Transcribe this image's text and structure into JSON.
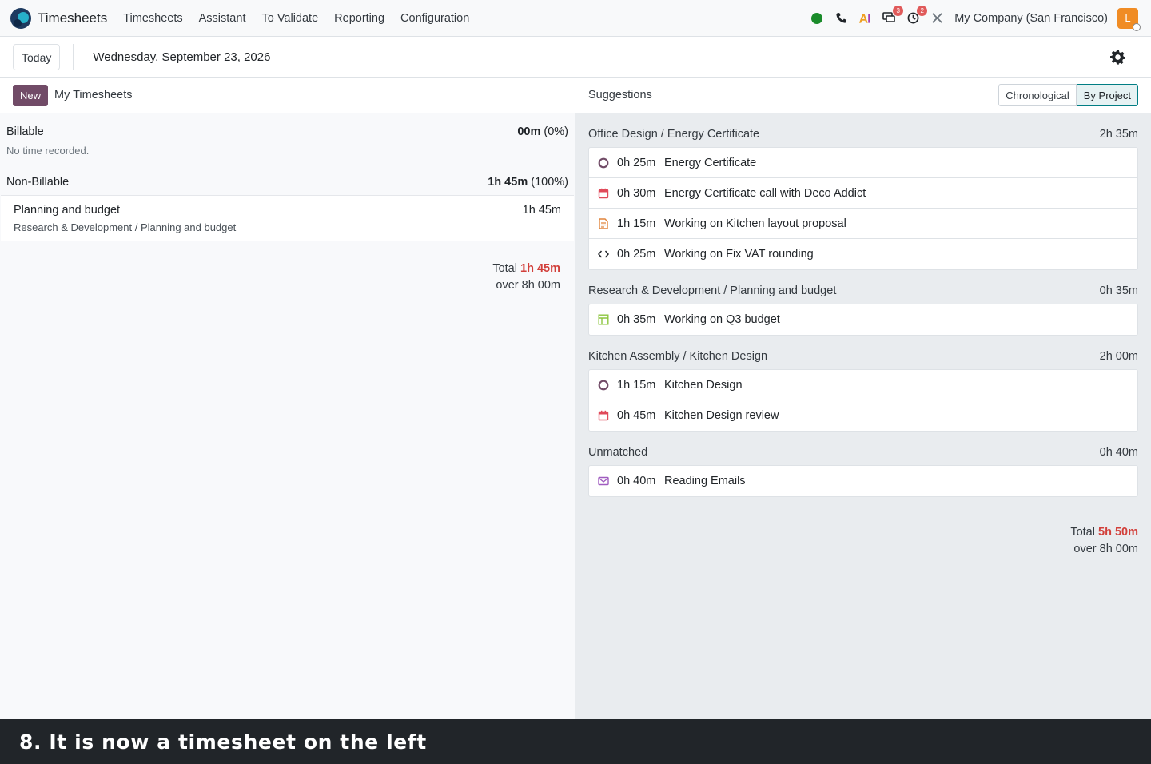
{
  "navbar": {
    "app_name": "Timesheets",
    "menu": [
      "Timesheets",
      "Assistant",
      "To Validate",
      "Reporting",
      "Configuration"
    ],
    "company": "My Company (San Francisco)",
    "avatar_letter": "L",
    "badges": {
      "messages": "3",
      "activities": "2"
    },
    "icons": [
      "status-online-icon",
      "phone-icon",
      "ai-icon",
      "chat-icon",
      "clock-icon",
      "tools-icon"
    ]
  },
  "controlbar": {
    "today_label": "Today",
    "date": "Wednesday, September 23, 2026"
  },
  "left": {
    "new_label": "New",
    "title": "My Timesheets",
    "billable": {
      "label": "Billable",
      "value": "00m",
      "percent": "(0%)",
      "empty_text": "No time recorded."
    },
    "non_billable": {
      "label": "Non-Billable",
      "value": "1h 45m",
      "percent": "(100%)"
    },
    "entries": [
      {
        "title": "Planning and budget",
        "subtitle": "Research & Development / Planning and budget",
        "duration": "1h 45m"
      }
    ],
    "total_label": "Total",
    "total_value": "1h 45m",
    "over_text": "over 8h 00m"
  },
  "right": {
    "title": "Suggestions",
    "view_chronological": "Chronological",
    "view_by_project": "By Project",
    "groups": [
      {
        "name": "Office Design / Energy Certificate",
        "total": "2h 35m",
        "items": [
          {
            "icon": "task-circle-icon",
            "duration": "0h 25m",
            "name": "Energy Certificate"
          },
          {
            "icon": "calendar-icon",
            "duration": "0h 30m",
            "name": "Energy Certificate call with Deco Addict"
          },
          {
            "icon": "document-icon",
            "duration": "1h 15m",
            "name": "Working on Kitchen layout proposal"
          },
          {
            "icon": "code-icon",
            "duration": "0h 25m",
            "name": "Working on Fix VAT rounding"
          }
        ]
      },
      {
        "name": "Research & Development / Planning and budget",
        "total": "0h 35m",
        "items": [
          {
            "icon": "spreadsheet-icon",
            "duration": "0h 35m",
            "name": "Working on Q3 budget"
          }
        ]
      },
      {
        "name": "Kitchen Assembly / Kitchen Design",
        "total": "2h 00m",
        "items": [
          {
            "icon": "task-circle-icon",
            "duration": "1h 15m",
            "name": "Kitchen Design"
          },
          {
            "icon": "calendar-icon",
            "duration": "0h 45m",
            "name": "Kitchen Design review"
          }
        ]
      },
      {
        "name": "Unmatched",
        "total": "0h 40m",
        "items": [
          {
            "icon": "envelope-icon",
            "duration": "0h 40m",
            "name": "Reading Emails"
          }
        ]
      }
    ],
    "total_label": "Total",
    "total_value": "5h 50m",
    "over_text": "over 8h 00m"
  },
  "caption": "8. It is now a timesheet on the left"
}
